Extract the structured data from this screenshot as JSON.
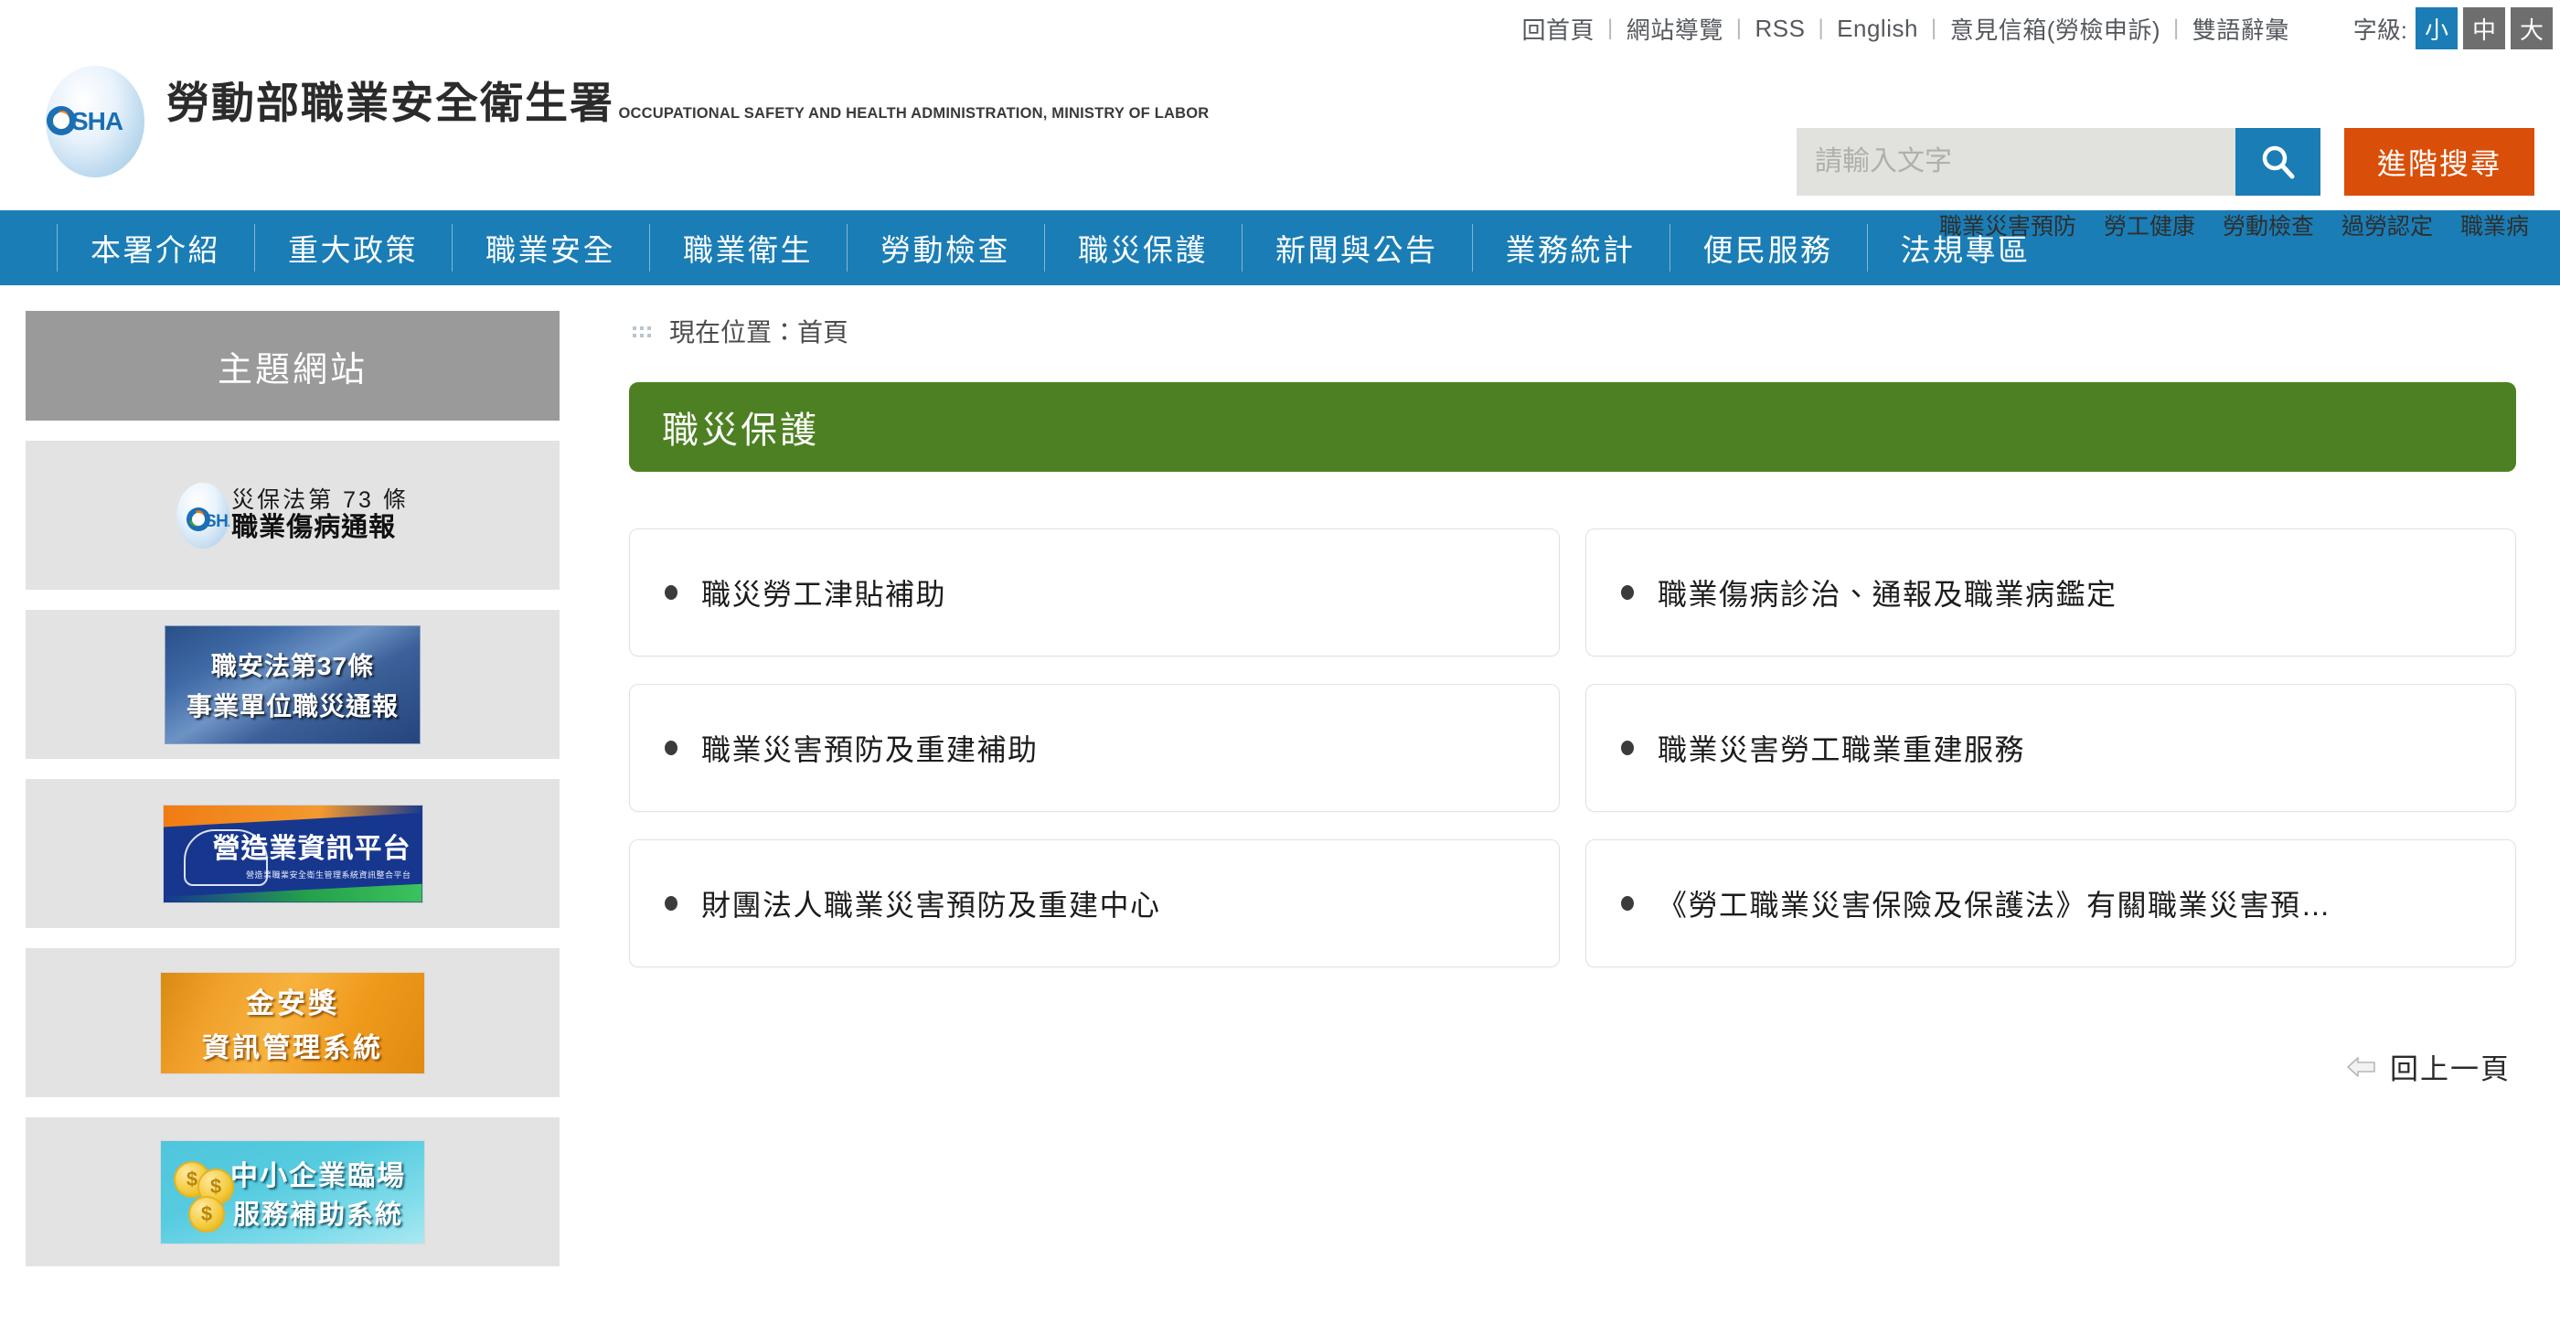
{
  "topbar": {
    "links": [
      "回首頁",
      "網站導覽",
      "RSS",
      "English",
      "意見信箱(勞檢申訴)",
      "雙語辭彙"
    ],
    "separator": "|",
    "fontsize_label": "字級:",
    "fontsize_options": [
      {
        "label": "小",
        "active": true
      },
      {
        "label": "中",
        "active": false
      },
      {
        "label": "大",
        "active": false
      }
    ]
  },
  "header": {
    "logo_alt": "osha-logo",
    "title_cn": "勞動部職業安全衛生署",
    "title_en": "OCCUPATIONAL SAFETY AND HEALTH ADMINISTRATION, MINISTRY OF LABOR",
    "search": {
      "placeholder": "請輸入文字",
      "value": "",
      "button_icon": "search-icon",
      "advanced_label": "進階搜尋"
    },
    "quick_links": [
      "職業災害預防",
      "勞工健康",
      "勞動檢查",
      "過勞認定",
      "職業病"
    ]
  },
  "mainnav": {
    "items": [
      "本署介紹",
      "重大政策",
      "職業安全",
      "職業衛生",
      "勞動檢查",
      "職災保護",
      "新聞與公告",
      "業務統計",
      "便民服務",
      "法規專區"
    ]
  },
  "sidebar": {
    "title": "主題網站",
    "banners": [
      {
        "name": "banner-occupational-injury-report",
        "type": "osha-text",
        "line1": "災保法第 73 條",
        "line2": "職業傷病通報"
      },
      {
        "name": "banner-article37-report",
        "type": "blue-photo",
        "line1": "職安法第37條",
        "line2": "事業單位職災通報"
      },
      {
        "name": "banner-construction-platform",
        "type": "construction",
        "line1": "營造業資訊平台",
        "line2": "營造業職業安全衛生管理系統資訊整合平台"
      },
      {
        "name": "banner-gold-safety-award",
        "type": "gold",
        "line1": "金安獎",
        "line2": "資訊管理系統"
      },
      {
        "name": "banner-sme-onsite-service",
        "type": "sme",
        "line1": "中小企業臨場",
        "line2": "服務補助系統"
      }
    ]
  },
  "content": {
    "breadcrumb": {
      "label": "現在位置：",
      "current": "首頁"
    },
    "page_title": "職災保護",
    "cards": [
      "職災勞工津貼補助",
      "職業傷病診治、通報及職業病鑑定",
      "職業災害預防及重建補助",
      "職業災害勞工職業重建服務",
      "財團法人職業災害預防及重建中心",
      "《勞工職業災害保險及保護法》有關職業災害預…"
    ],
    "back_label": "回上一頁",
    "back_icon": "left-arrow-icon"
  },
  "colors": {
    "nav_blue": "#1a7db5",
    "banner_green": "#4d8022",
    "accent_orange": "#d94e08",
    "sidebar_title_gray": "#9a9a9a",
    "banner_cell_gray": "#e3e3e3"
  }
}
